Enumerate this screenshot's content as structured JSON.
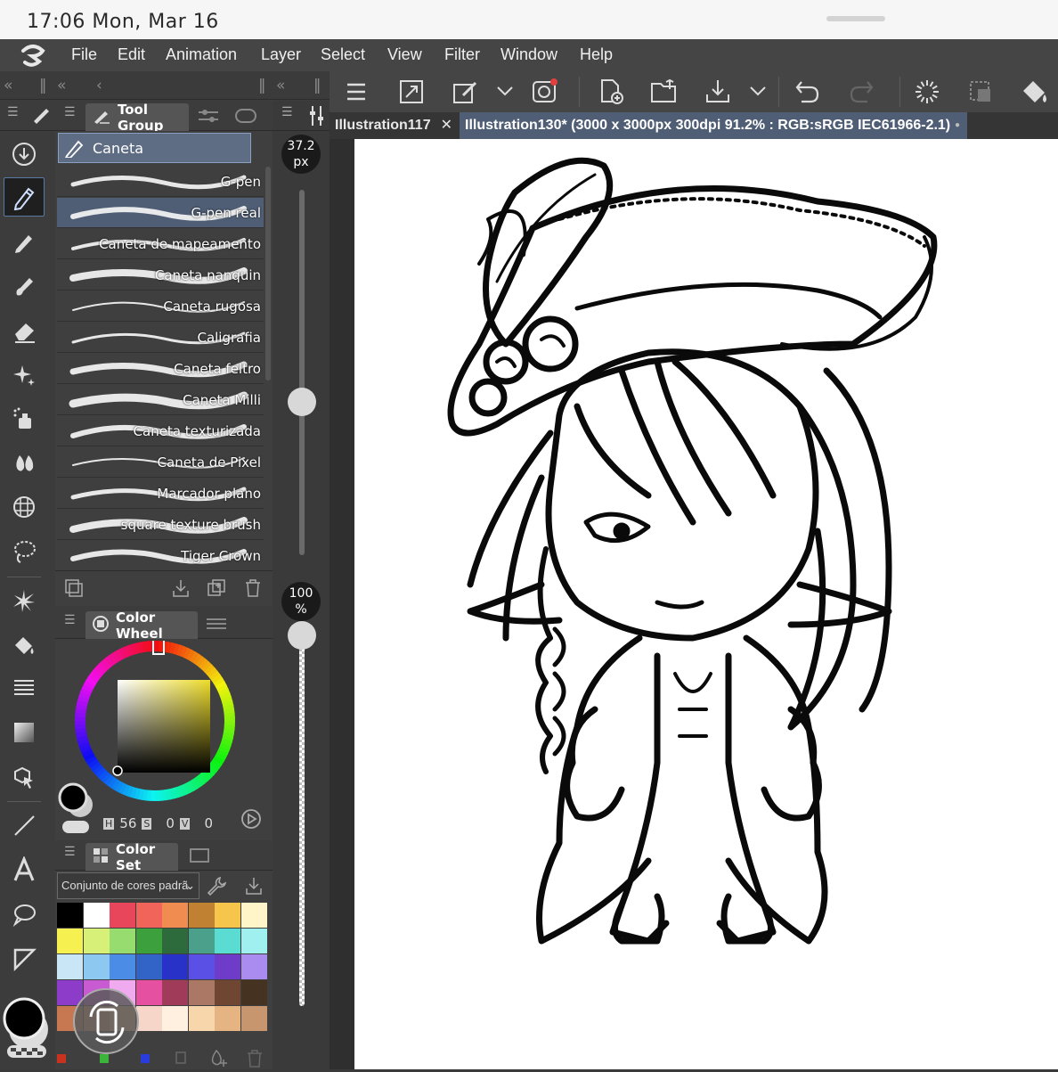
{
  "status_bar": {
    "time_date": "17:06   Mon, Mar 16"
  },
  "menu": [
    "File",
    "Edit",
    "Animation",
    "Layer",
    "Select",
    "View",
    "Filter",
    "Window",
    "Help"
  ],
  "tool_panel": {
    "tab_label": "Tool Group",
    "group_name": "Caneta",
    "brushes": [
      "G-pen",
      "G-pen real",
      "Caneta de mapeamento",
      "Caneta nanquin",
      "Caneta rugosa",
      "Caligrafia",
      "Caneta feltro",
      "Caneta Milli",
      "Caneta texturizada",
      "Caneta de Pixel",
      "Marcador plano",
      "square texture brush",
      "Tiger Crown"
    ],
    "selected_brush": "G-pen real"
  },
  "brush_size": {
    "value": "37.2",
    "unit": "px",
    "level": 0.42
  },
  "opacity": {
    "value": "100",
    "unit": "%",
    "level": 1.0
  },
  "color_wheel": {
    "title": "Color Wheel",
    "h_label": "H",
    "h_value": "56",
    "s_label": "S",
    "s_value": "0",
    "v_label": "V",
    "v_value": "0",
    "current_color": "#000000"
  },
  "color_set": {
    "title": "Color Set",
    "set_name": "Conjunto de cores padrã",
    "swatches": [
      "#000000",
      "#ffffff",
      "#e8465a",
      "#f0645a",
      "#f08c50",
      "#c08232",
      "#f6c54c",
      "#fff5c8",
      "#f6f050",
      "#d6f078",
      "#96dc6e",
      "#3ca03c",
      "#2d6a3c",
      "#4ba08c",
      "#5adcd2",
      "#a0f0f0",
      "#c8e6f6",
      "#8cc8f0",
      "#4b8ce6",
      "#3264c8",
      "#2832c8",
      "#5a50e6",
      "#6e3cc8",
      "#aa8cf0",
      "#8c3cc8",
      "#c85ad2",
      "#f0aaf0",
      "#e650a0",
      "#a03c5a",
      "#aa7864",
      "#6e4632",
      "#463220",
      "#c87850",
      "#dc8c64",
      "#f0b48c",
      "#f6d6c8",
      "#fff0e0",
      "#f6d6aa",
      "#e6b482",
      "#c8966e"
    ]
  },
  "tabs": [
    {
      "label": "Illustration117",
      "close": "✕"
    },
    {
      "label": "Illustration130* (3000 x 3000px 300dpi 91.2% : RGB:sRGB IEC61966-2.1)",
      "dot": "●"
    }
  ],
  "colors": {
    "accent": "#5e6c84",
    "panel": "#3f3f3f",
    "menubar": "#454545"
  }
}
